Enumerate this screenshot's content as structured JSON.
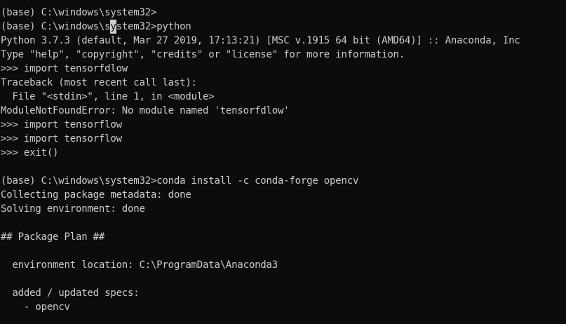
{
  "terminal": {
    "lines": [
      "(base) C:\\windows\\system32>",
      "",
      "Python 3.7.3 (default, Mar 27 2019, 17:13:21) [MSC v.1915 64 bit (AMD64)] :: Anaconda, Inc",
      "Type \"help\", \"copyright\", \"credits\" or \"license\" for more information.",
      ">>> import tensorfdlow",
      "Traceback (most recent call last):",
      "  File \"<stdin>\", line 1, in <module>",
      "ModuleNotFoundError: No module named 'tensorfdlow'",
      ">>> import tensorflow",
      ">>> import tensorflow",
      ">>> exit()",
      "",
      "(base) C:\\windows\\system32>conda install -c conda-forge opencv",
      "Collecting package metadata: done",
      "Solving environment: done",
      "",
      "## Package Plan ##",
      "",
      "  environment location: C:\\ProgramData\\Anaconda3",
      "",
      "  added / updated specs:",
      "    - opencv"
    ],
    "cursor_line": {
      "before": "(base) C:\\windows\\s",
      "cursor_char": "y",
      "after": "stem32>python"
    }
  },
  "colors": {
    "background": "#0c0c0c",
    "text": "#cccccc"
  }
}
